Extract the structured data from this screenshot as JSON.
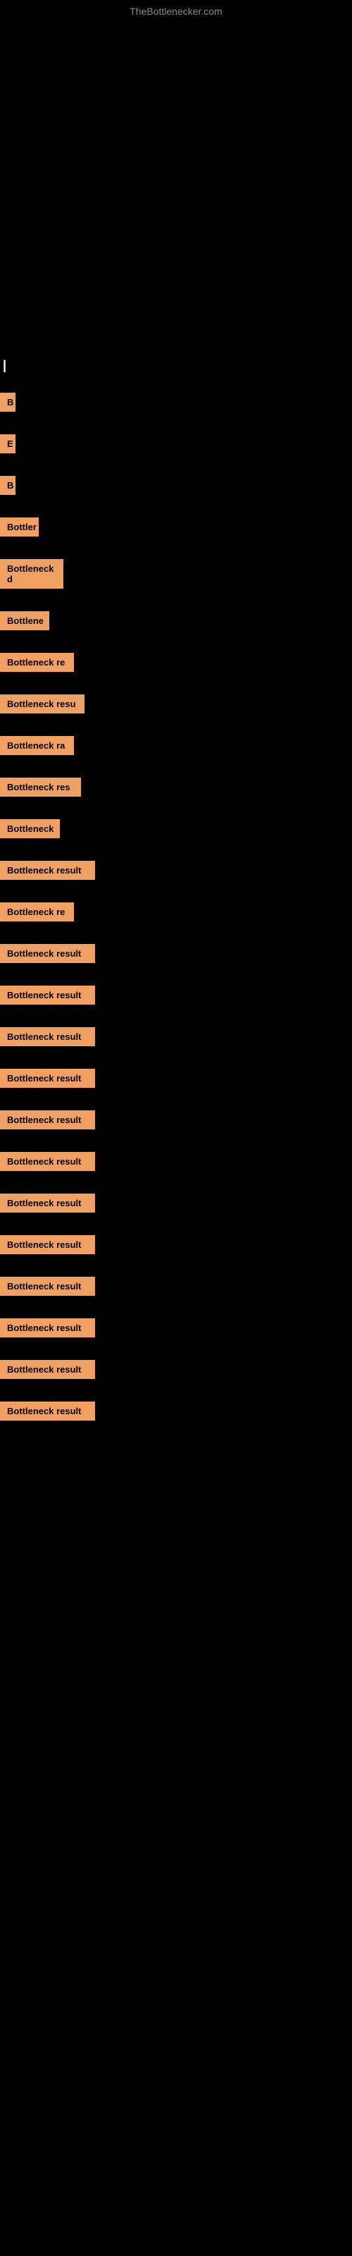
{
  "site": {
    "title": "TheBottlenecker.com"
  },
  "section": {
    "label": "|"
  },
  "items": [
    {
      "id": 1,
      "label": "B",
      "width": 22
    },
    {
      "id": 2,
      "label": "E",
      "width": 22
    },
    {
      "id": 3,
      "label": "B",
      "width": 22
    },
    {
      "id": 4,
      "label": "Bottler",
      "width": 55
    },
    {
      "id": 5,
      "label": "Bottleneck d",
      "width": 90
    },
    {
      "id": 6,
      "label": "Bottlene",
      "width": 70
    },
    {
      "id": 7,
      "label": "Bottleneck re",
      "width": 105
    },
    {
      "id": 8,
      "label": "Bottleneck resu",
      "width": 120
    },
    {
      "id": 9,
      "label": "Bottleneck ra",
      "width": 105
    },
    {
      "id": 10,
      "label": "Bottleneck res",
      "width": 115
    },
    {
      "id": 11,
      "label": "Bottleneck",
      "width": 85
    },
    {
      "id": 12,
      "label": "Bottleneck result",
      "width": 135
    },
    {
      "id": 13,
      "label": "Bottleneck re",
      "width": 105
    },
    {
      "id": 14,
      "label": "Bottleneck result",
      "width": 135
    },
    {
      "id": 15,
      "label": "Bottleneck result",
      "width": 135
    },
    {
      "id": 16,
      "label": "Bottleneck result",
      "width": 135
    },
    {
      "id": 17,
      "label": "Bottleneck result",
      "width": 135
    },
    {
      "id": 18,
      "label": "Bottleneck result",
      "width": 135
    },
    {
      "id": 19,
      "label": "Bottleneck result",
      "width": 135
    },
    {
      "id": 20,
      "label": "Bottleneck result",
      "width": 135
    },
    {
      "id": 21,
      "label": "Bottleneck result",
      "width": 135
    },
    {
      "id": 22,
      "label": "Bottleneck result",
      "width": 135
    },
    {
      "id": 23,
      "label": "Bottleneck result",
      "width": 135
    },
    {
      "id": 24,
      "label": "Bottleneck result",
      "width": 135
    },
    {
      "id": 25,
      "label": "Bottleneck result",
      "width": 135
    }
  ]
}
